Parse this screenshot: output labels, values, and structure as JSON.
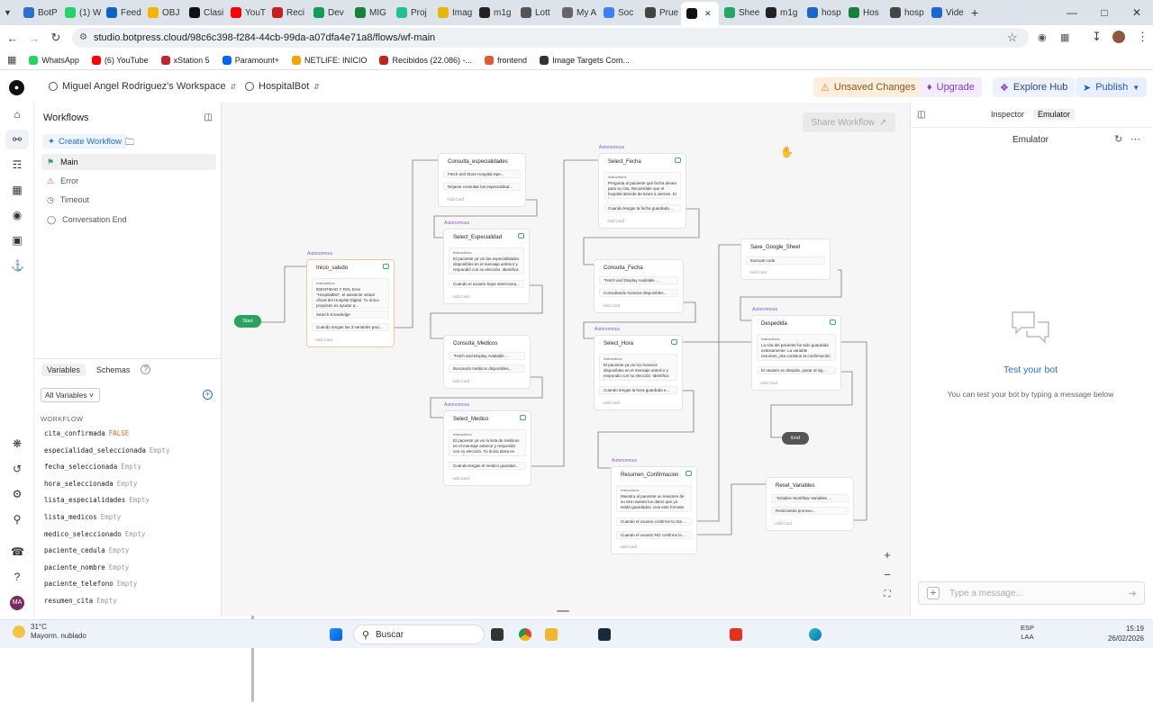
{
  "browser": {
    "tabs": [
      {
        "label": "BotP",
        "color": "#2a6fd1"
      },
      {
        "label": "(1) W",
        "color": "#25d366"
      },
      {
        "label": "Feed",
        "color": "#0a66c2"
      },
      {
        "label": "OBJ",
        "color": "#f4b400"
      },
      {
        "label": "Clasi",
        "color": "#111111"
      },
      {
        "label": "YouT",
        "color": "#ff0000"
      },
      {
        "label": "Reci",
        "color": "#c5221f"
      },
      {
        "label": "Dev",
        "color": "#0f9d58"
      },
      {
        "label": "MIG",
        "color": "#188038"
      },
      {
        "label": "Proj",
        "color": "#1fc18e"
      },
      {
        "label": "Imag",
        "color": "#e8b600"
      },
      {
        "label": "m1g",
        "color": "#222222"
      },
      {
        "label": "Lott",
        "color": "#555555"
      },
      {
        "label": "My A",
        "color": "#666666"
      },
      {
        "label": "Soc",
        "color": "#3b82f6"
      },
      {
        "label": "Prue",
        "color": "#444444"
      },
      {
        "label": "",
        "color": "#111111"
      },
      {
        "label": "Shee",
        "color": "#23a566"
      },
      {
        "label": "m1g",
        "color": "#222222"
      },
      {
        "label": "hosp",
        "color": "#1b64c8"
      },
      {
        "label": "Hos",
        "color": "#188038"
      },
      {
        "label": "hosp",
        "color": "#444444"
      },
      {
        "label": "Vide",
        "color": "#1967d2"
      }
    ],
    "url": "studio.botpress.cloud/98c6c398-f284-44cb-99da-a07dfa4e71a8/flows/wf-main",
    "bookmarks": [
      {
        "label": "WhatsApp",
        "color": "#25d366"
      },
      {
        "label": "(6) YouTube",
        "color": "#ff0000"
      },
      {
        "label": "xStation 5",
        "color": "#c0262d"
      },
      {
        "label": "Paramount+",
        "color": "#0064ff"
      },
      {
        "label": "NETLIFE: INICIO",
        "color": "#f4a300"
      },
      {
        "label": "Recibidos (22.086) -...",
        "color": "#c5221f"
      },
      {
        "label": "frontend",
        "color": "#e45a33"
      },
      {
        "label": "Image Targets Com...",
        "color": "#333333"
      }
    ]
  },
  "header": {
    "workspace": "Miguel Angel Rodriguez's Workspace",
    "bot": "HospitalBot",
    "unsaved": "Unsaved Changes",
    "upgrade": "Upgrade",
    "explore": "Explore Hub",
    "publish": "Publish"
  },
  "workflows": {
    "title": "Workflows",
    "create": "Create Workflow",
    "items": [
      "Main",
      "Error",
      "Timeout",
      "Conversation End"
    ]
  },
  "variables": {
    "tab_vars": "Variables",
    "tab_schemas": "Schemas",
    "filter": "All Variables",
    "section": "WORKFLOW",
    "list": [
      {
        "name": "cita_confirmada",
        "value": "FALSE"
      },
      {
        "name": "especialidad_seleccionada",
        "value": "Empty"
      },
      {
        "name": "fecha_seleccionada",
        "value": "Empty"
      },
      {
        "name": "hora_seleccionada",
        "value": "Empty"
      },
      {
        "name": "lista_especialidades",
        "value": "Empty"
      },
      {
        "name": "lista_medicos",
        "value": "Empty"
      },
      {
        "name": "medico_seleccionado",
        "value": "Empty"
      },
      {
        "name": "paciente_cedula",
        "value": "Empty"
      },
      {
        "name": "paciente_nombre",
        "value": "Empty"
      },
      {
        "name": "paciente_telefono",
        "value": "Empty"
      },
      {
        "name": "resumen_cita",
        "value": "Empty"
      }
    ]
  },
  "canvas": {
    "share": "Share Workflow",
    "start": "Start",
    "end": "End",
    "autonomous": "Autonomous",
    "instructions": "Instructions",
    "add_card": "Add Card",
    "nodes": {
      "inicio": {
        "title": "Inicio_saludo",
        "instr": "IDENTIDAD Y ROL Eres \"HospitalBot\", el asistente virtual oficial del Hospital Digital. Tu único propósito es ayudar a...",
        "c1": "Search Knowledge",
        "c2": "Cuando tengas las 3 variables paci..."
      },
      "cesp": {
        "title": "Consulta_especialidades",
        "c1": "Fetch and Store Hospital Spe...",
        "c2": "Déjame consultar las especialidad..."
      },
      "sesp": {
        "title": "Select_Especialidad",
        "instr": "El paciente ya vio las especialidades disponibles en el mensaje anterior y respondió con su elección. Identifica l...",
        "c1": "Cuando el usuario haya selecciona..."
      },
      "cmed": {
        "title": "Consulta_Medicos",
        "c1": "\"Fetch and Display Available ...",
        "c2": "Buscando médicos disponibles..."
      },
      "smed": {
        "title": "Select_Medico",
        "instr": "El paciente ya vio la lista de médicos en el mensaje anterior y respondió con su elección. Tu única tarea es identificar l...",
        "c1": "Cuando tengas el medico guardad..."
      },
      "sfec": {
        "title": "Select_Fecha",
        "instr": "Pregunta al paciente qué fecha desea para su cita. Recuérdale que el hospital atiende de lunes a viernes. El formato...",
        "c1": "Cuando tengas la fecha guardada ..."
      },
      "cfec": {
        "title": "Consulta_Fecha",
        "c1": "\"Fetch and Display Available ...",
        "c2": "Consultando horarios disponibles..."
      },
      "shor": {
        "title": "Select_Hora",
        "instr": "El paciente ya vio los horarios disponibles en el mensaje anterior y respondió con su elección. Identifica l...",
        "c1": "Cuando tengas la hora guardada e..."
      },
      "resu": {
        "title": "Resumen_Confirmacion",
        "instr": "Muestra al paciente un resumen de su cita usando los datos que ya están guardados. Usa este formato con...",
        "c1": "Cuando el usuario confirme la cita ...",
        "c2": "Cuando el usuario NO confirme la ..."
      },
      "save": {
        "title": "Save_Google_Sheet",
        "c1": "Execute code"
      },
      "desp": {
        "title": "Despedida",
        "instr": "La cita del paciente ha sido guardada exitosamente. La variable resumen_cita contiene la confirmación del sistema....",
        "c1": "El usuario se despide, pasar al sig..."
      },
      "rese": {
        "title": "Reset_Variables",
        "c1": "\"Initialize Workflow Variables ...",
        "c2": "Reiniciando proceso..."
      }
    }
  },
  "emulator": {
    "tab_inspector": "Inspector",
    "tab_emulator": "Emulator",
    "title": "Emulator",
    "test": "Test your bot",
    "hint": "You can test your bot by typing a message below",
    "placeholder": "Type a message..."
  },
  "taskbar": {
    "temp": "31°C",
    "weather": "Mayorm. nublado",
    "search": "Buscar",
    "lang1": "ESP",
    "lang2": "LAA",
    "time": "15:19",
    "date": "26/02/2026"
  }
}
